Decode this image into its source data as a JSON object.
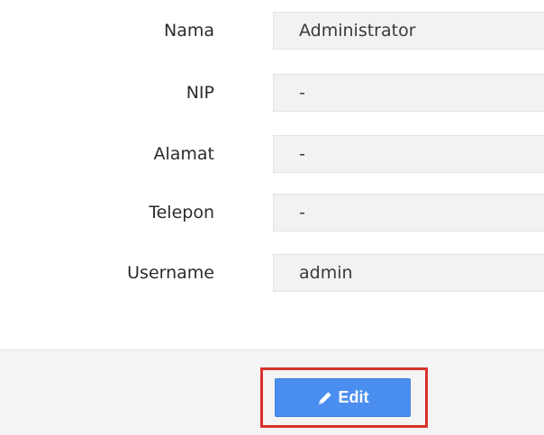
{
  "form": {
    "fields": [
      {
        "label": "Nama",
        "value": "Administrator"
      },
      {
        "label": "NIP",
        "value": "-"
      },
      {
        "label": "Alamat",
        "value": "-"
      },
      {
        "label": "Telepon",
        "value": "-"
      },
      {
        "label": "Username",
        "value": "admin"
      }
    ]
  },
  "footer": {
    "edit_button": {
      "label": "Edit",
      "icon": "pencil-icon"
    },
    "highlight_color": "#d9322a",
    "button_color": "#4a8ef0"
  }
}
